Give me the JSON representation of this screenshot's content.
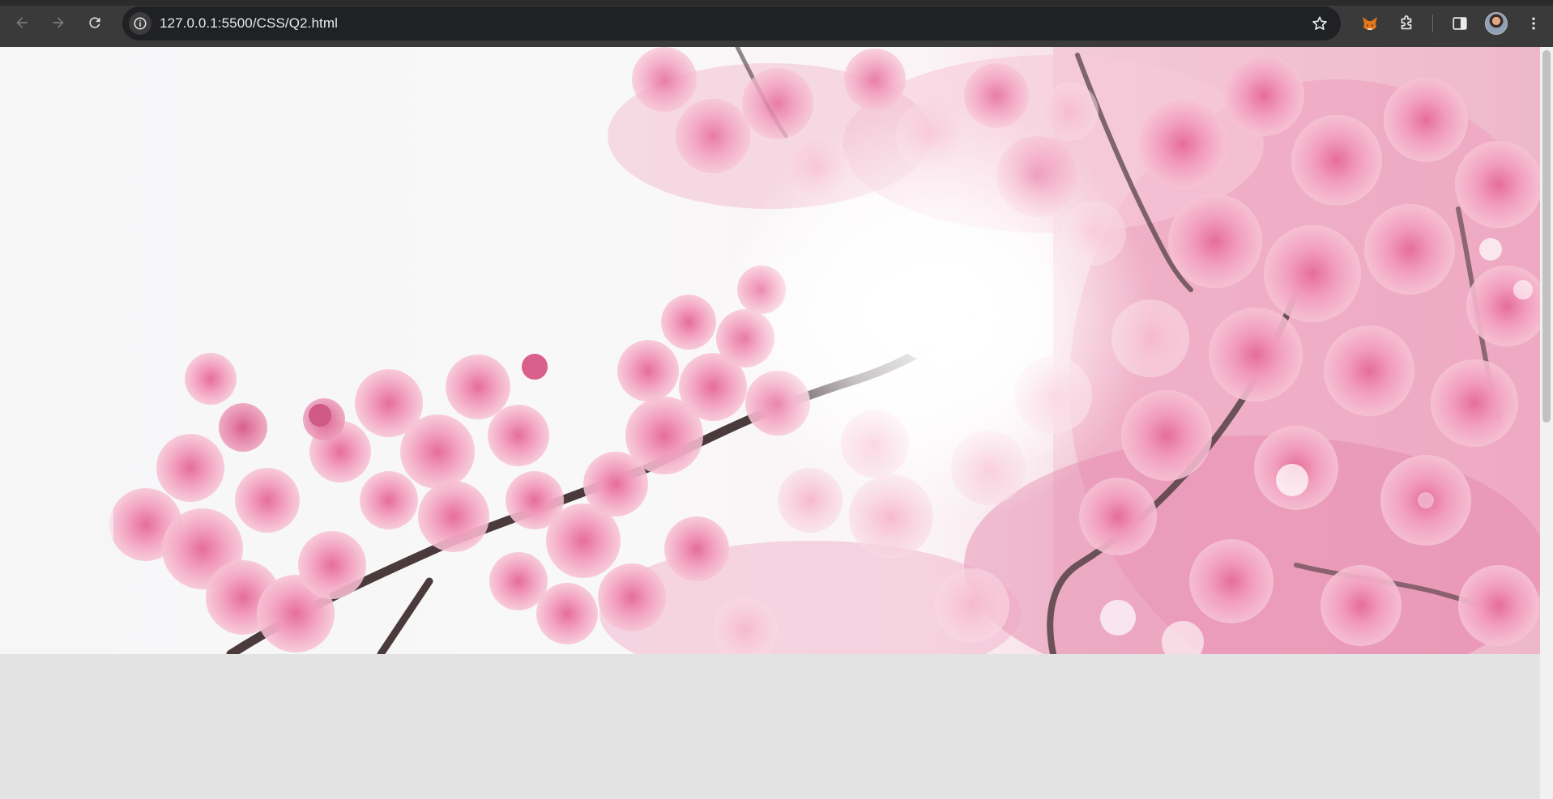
{
  "browser": {
    "url": "127.0.0.1:5500/CSS/Q2.html",
    "icons": {
      "back": "arrow-left-icon",
      "forward": "arrow-right-icon",
      "reload": "reload-icon",
      "site_info": "info-icon",
      "bookmark": "star-icon",
      "extension_metamask": "fox-icon",
      "extensions": "puzzle-icon",
      "side_panel": "side-panel-icon",
      "profile": "avatar",
      "menu": "kebab-menu-icon"
    }
  },
  "page": {
    "hero_image": {
      "subject": "cherry-blossom-branch",
      "colors": {
        "petal": "#f3a9c4",
        "petal_deep": "#e37aa2",
        "branch": "#4a3838",
        "sky": "#f6f6f7"
      }
    },
    "background_color": "#e3e3e3"
  }
}
